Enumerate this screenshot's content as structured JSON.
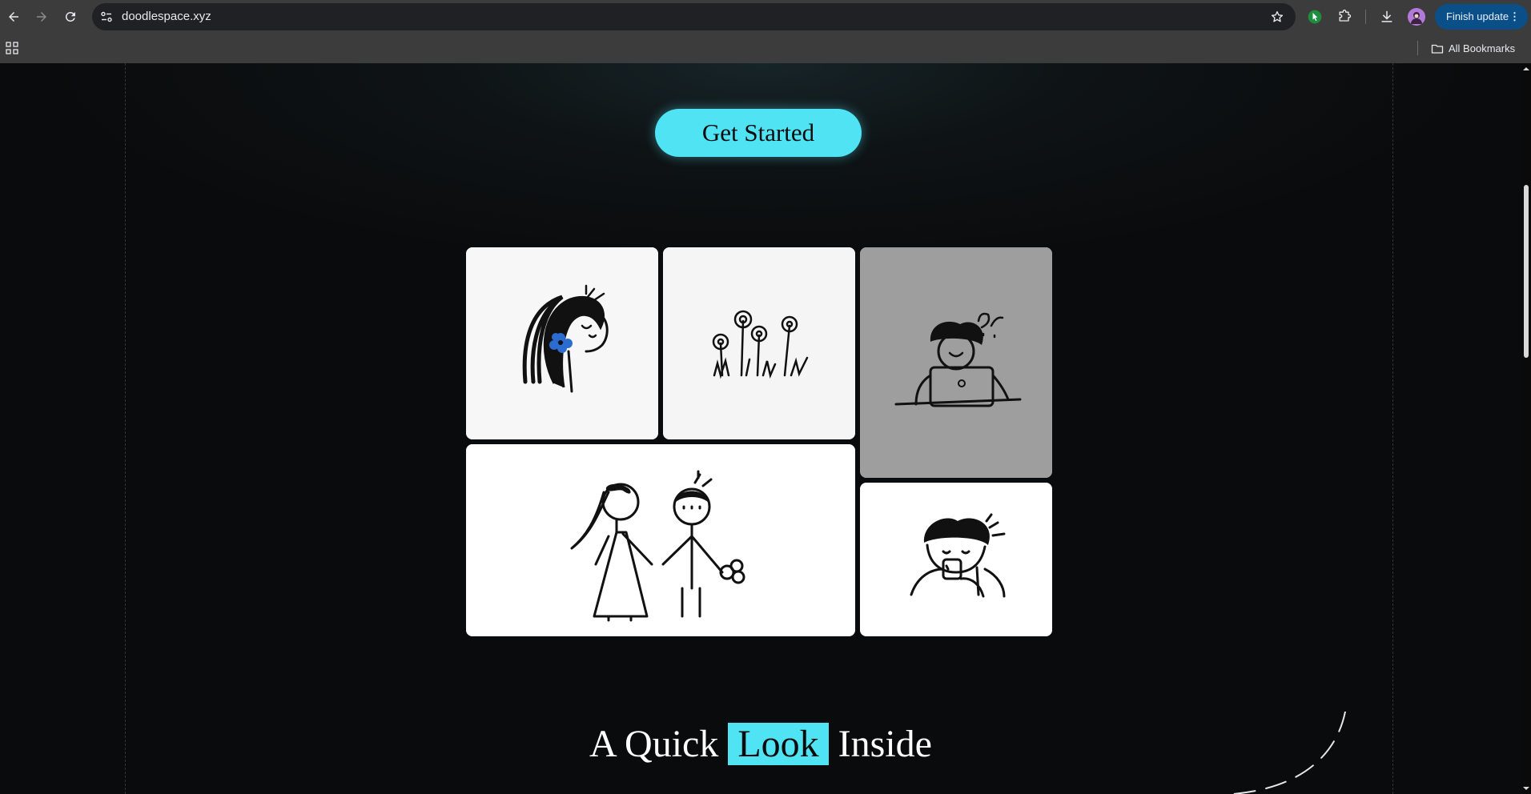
{
  "browser": {
    "url": "doodlespace.xyz",
    "update_label": "Finish update",
    "update_menu_glyph": "⋮",
    "all_bookmarks_label": "All Bookmarks",
    "accent": "#0b4f88"
  },
  "page": {
    "cta_label": "Get Started",
    "gallery": [
      {
        "name": "girl-with-flower",
        "alt": "Doodle of a girl with a blue flower in her hair"
      },
      {
        "name": "wildflowers",
        "alt": "Doodle of wildflowers in grass"
      },
      {
        "name": "boy-at-laptop",
        "alt": "Doodle of a boy working on a laptop"
      },
      {
        "name": "couple-holding-hands",
        "alt": "Doodle of a couple holding hands with a flower"
      },
      {
        "name": "boy-drinking",
        "alt": "Doodle of a boy sipping from a cup"
      }
    ],
    "heading": {
      "before": "A Quick",
      "highlight": "Look",
      "after": "Inside"
    },
    "accent": "#4fe3f3"
  }
}
